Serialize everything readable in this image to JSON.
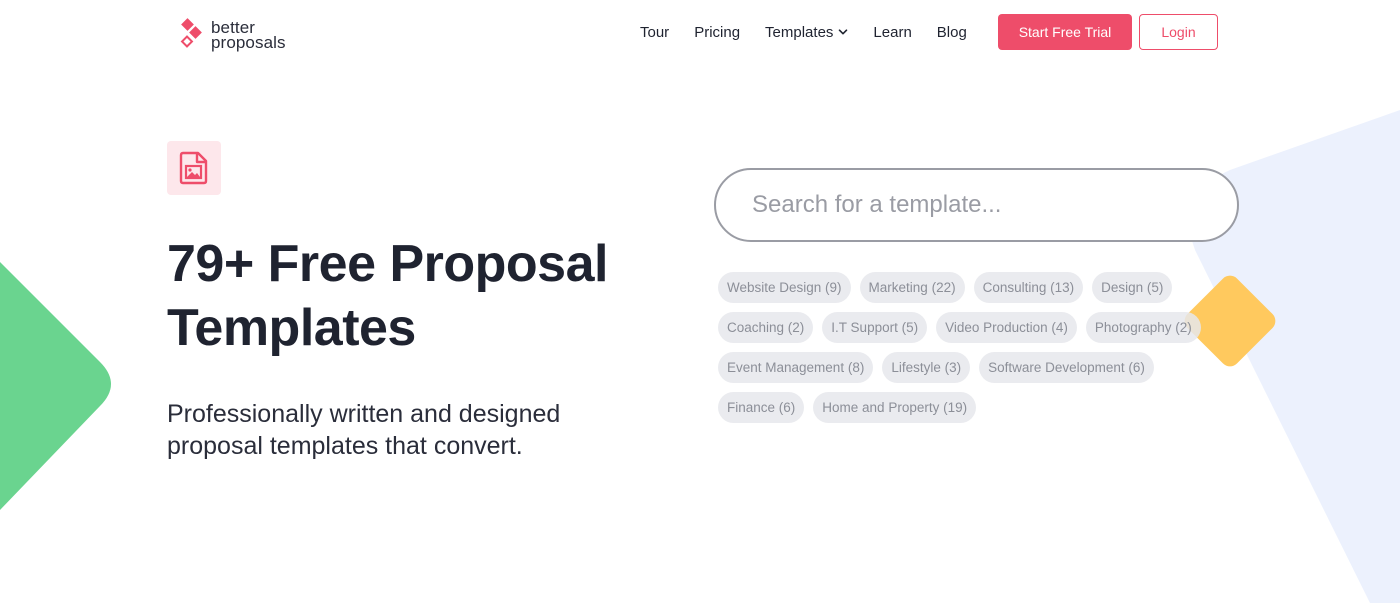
{
  "brand": {
    "name_line1": "better",
    "name_line2": "proposals",
    "accent": "#ee4d6a"
  },
  "nav": {
    "items": [
      {
        "label": "Tour"
      },
      {
        "label": "Pricing"
      },
      {
        "label": "Templates"
      },
      {
        "label": "Learn"
      },
      {
        "label": "Blog"
      }
    ],
    "cta_label": "Start Free Trial",
    "login_label": "Login"
  },
  "hero": {
    "icon": "document-image-icon",
    "title": "79+ Free Proposal Templates",
    "subtitle": "Professionally written and designed proposal templates that convert."
  },
  "search": {
    "placeholder": "Search for a template...",
    "value": ""
  },
  "categories": [
    {
      "label": "Website Design (9)"
    },
    {
      "label": "Marketing (22)"
    },
    {
      "label": "Consulting (13)"
    },
    {
      "label": "Design (5)"
    },
    {
      "label": "Coaching (2)"
    },
    {
      "label": "I.T Support (5)"
    },
    {
      "label": "Video Production (4)"
    },
    {
      "label": "Photography (2)"
    },
    {
      "label": "Event Management (8)"
    },
    {
      "label": "Lifestyle (3)"
    },
    {
      "label": "Software Development (6)"
    },
    {
      "label": "Finance (6)"
    },
    {
      "label": "Home and Property (19)"
    }
  ],
  "colors": {
    "green_shape": "#6ad48f",
    "yellow_shape": "#ffc95e",
    "blue_shape": "#ecf1fd"
  }
}
